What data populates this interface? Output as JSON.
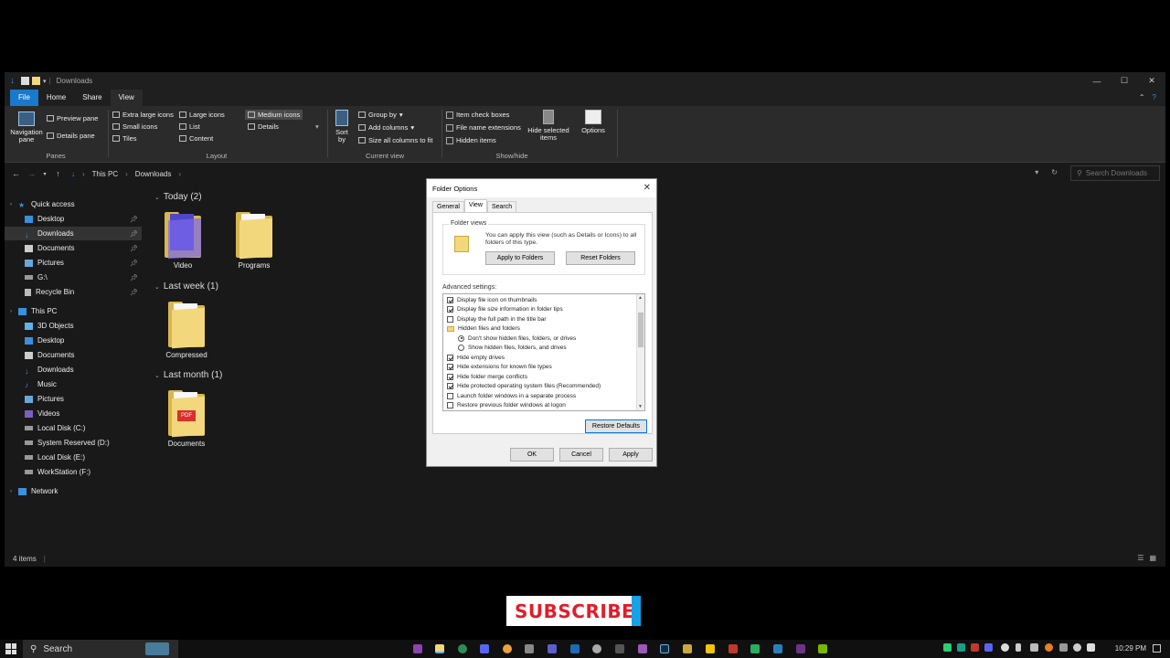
{
  "window": {
    "title": "Downloads",
    "controls": [
      "—",
      "☐",
      "✕"
    ]
  },
  "ribbon_tabs": [
    "File",
    "Home",
    "Share",
    "View"
  ],
  "ribbon": {
    "panes": {
      "label": "Panes",
      "navigation_pane": "Navigation pane",
      "preview_pane": "Preview pane",
      "details_pane": "Details pane"
    },
    "layout": {
      "label": "Layout",
      "options": [
        "Extra large icons",
        "Large icons",
        "Medium icons",
        "Small icons",
        "List",
        "Details",
        "Tiles",
        "Content"
      ],
      "selected": "Medium icons"
    },
    "current_view": {
      "label": "Current view",
      "sort_by": "Sort by",
      "group_by": "Group by",
      "add_columns": "Add columns",
      "size_all": "Size all columns to fit"
    },
    "show_hide": {
      "label": "Show/hide",
      "item_check_boxes": "Item check boxes",
      "file_name_extensions": "File name extensions",
      "hidden_items": "Hidden items",
      "hide_selected": "Hide selected items",
      "options": "Options"
    }
  },
  "address": {
    "crumbs": [
      "This PC",
      "Downloads"
    ],
    "search_placeholder": "Search Downloads"
  },
  "sidebar": {
    "quick_access": "Quick access",
    "quick_items": [
      "Desktop",
      "Downloads",
      "Documents",
      "Pictures",
      "G:\\",
      "Recycle Bin"
    ],
    "this_pc": "This PC",
    "pc_items": [
      "3D Objects",
      "Desktop",
      "Documents",
      "Downloads",
      "Music",
      "Pictures",
      "Videos",
      "Local Disk (C:)",
      "System Reserved (D:)",
      "Local Disk (E:)",
      "WorkStation (F:)"
    ],
    "network": "Network"
  },
  "groups": [
    {
      "label": "Today (2)",
      "items": [
        "Video",
        "Programs"
      ]
    },
    {
      "label": "Last week (1)",
      "items": [
        "Compressed"
      ]
    },
    {
      "label": "Last month (1)",
      "items": [
        "Documents"
      ]
    }
  ],
  "status": {
    "count": "4 items"
  },
  "dialog": {
    "title": "Folder Options",
    "tabs": [
      "General",
      "View",
      "Search"
    ],
    "folder_views_legend": "Folder views",
    "folder_views_text": "You can apply this view (such as Details or Icons) to all folders of this type.",
    "apply_to_folders": "Apply to Folders",
    "reset_folders": "Reset Folders",
    "advanced_label": "Advanced settings:",
    "advanced": [
      "Display file icon on thumbnails",
      "Display file size information in folder tips",
      "Display the full path in the title bar",
      "Hidden files and folders",
      "Don't show hidden files, folders, or drives",
      "Show hidden files, folders, and drives",
      "Hide empty drives",
      "Hide extensions for known file types",
      "Hide folder merge conflicts",
      "Hide protected operating system files (Recommended)",
      "Launch folder windows in a separate process",
      "Restore previous folder windows at logon"
    ],
    "restore_defaults": "Restore Defaults",
    "ok": "OK",
    "cancel": "Cancel",
    "apply": "Apply"
  },
  "overlay": {
    "subscribe": "SUBSCRIBE"
  },
  "taskbar": {
    "search": "Search",
    "clock": "10:29 PM"
  },
  "colors": {
    "accent": "#1979ca",
    "folder": "#f2d77c",
    "subscribe_red": "#e11d2a",
    "subscribe_blue": "#14a3e6"
  }
}
